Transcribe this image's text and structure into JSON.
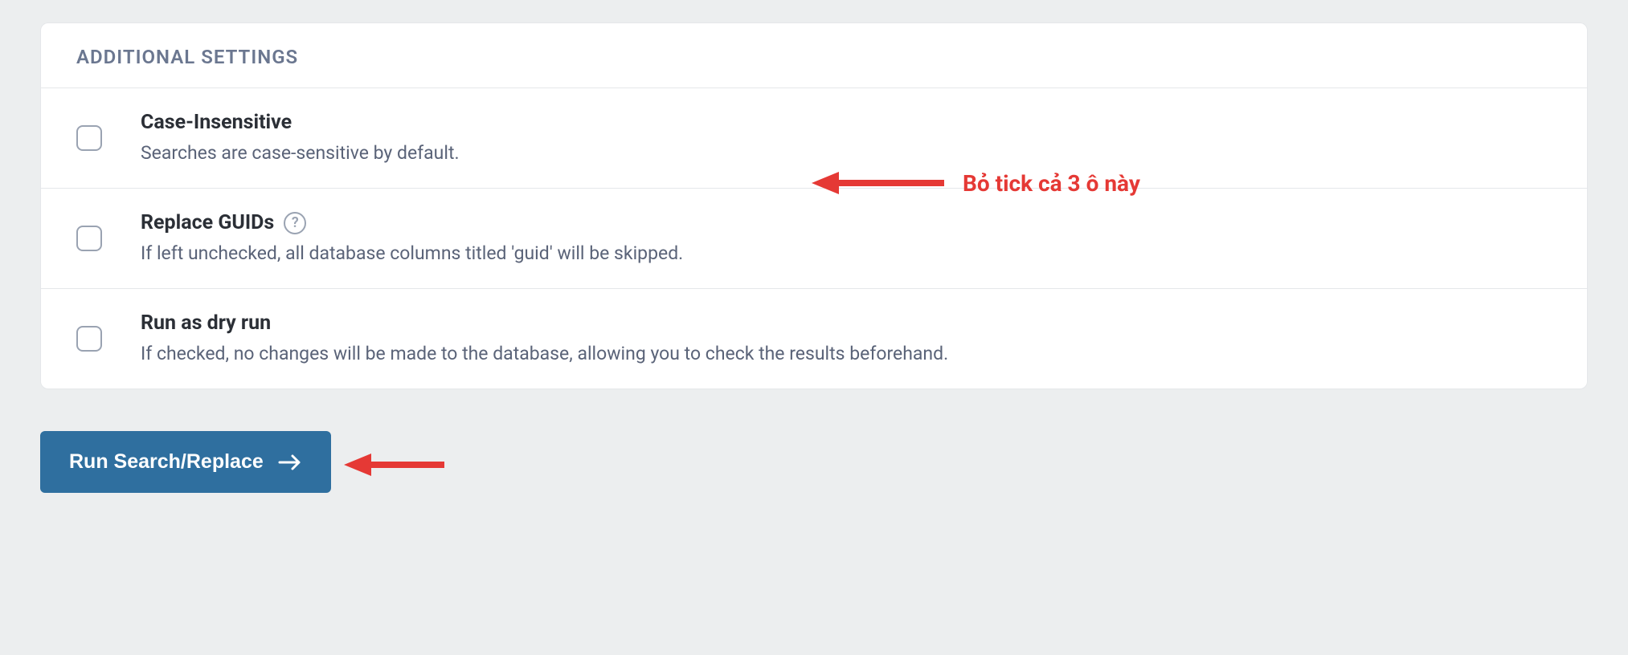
{
  "card": {
    "title": "ADDITIONAL SETTINGS",
    "settings": [
      {
        "title": "Case-Insensitive",
        "desc": "Searches are case-sensitive by default.",
        "help": false
      },
      {
        "title": "Replace GUIDs",
        "desc": "If left unchecked, all database columns titled 'guid' will be skipped.",
        "help": true
      },
      {
        "title": "Run as dry run",
        "desc": "If checked, no changes will be made to the database, allowing you to check the results beforehand.",
        "help": false
      }
    ]
  },
  "button": {
    "label": "Run Search/Replace"
  },
  "annotations": {
    "uncheck_hint": "Bỏ tick cả 3 ô này"
  }
}
